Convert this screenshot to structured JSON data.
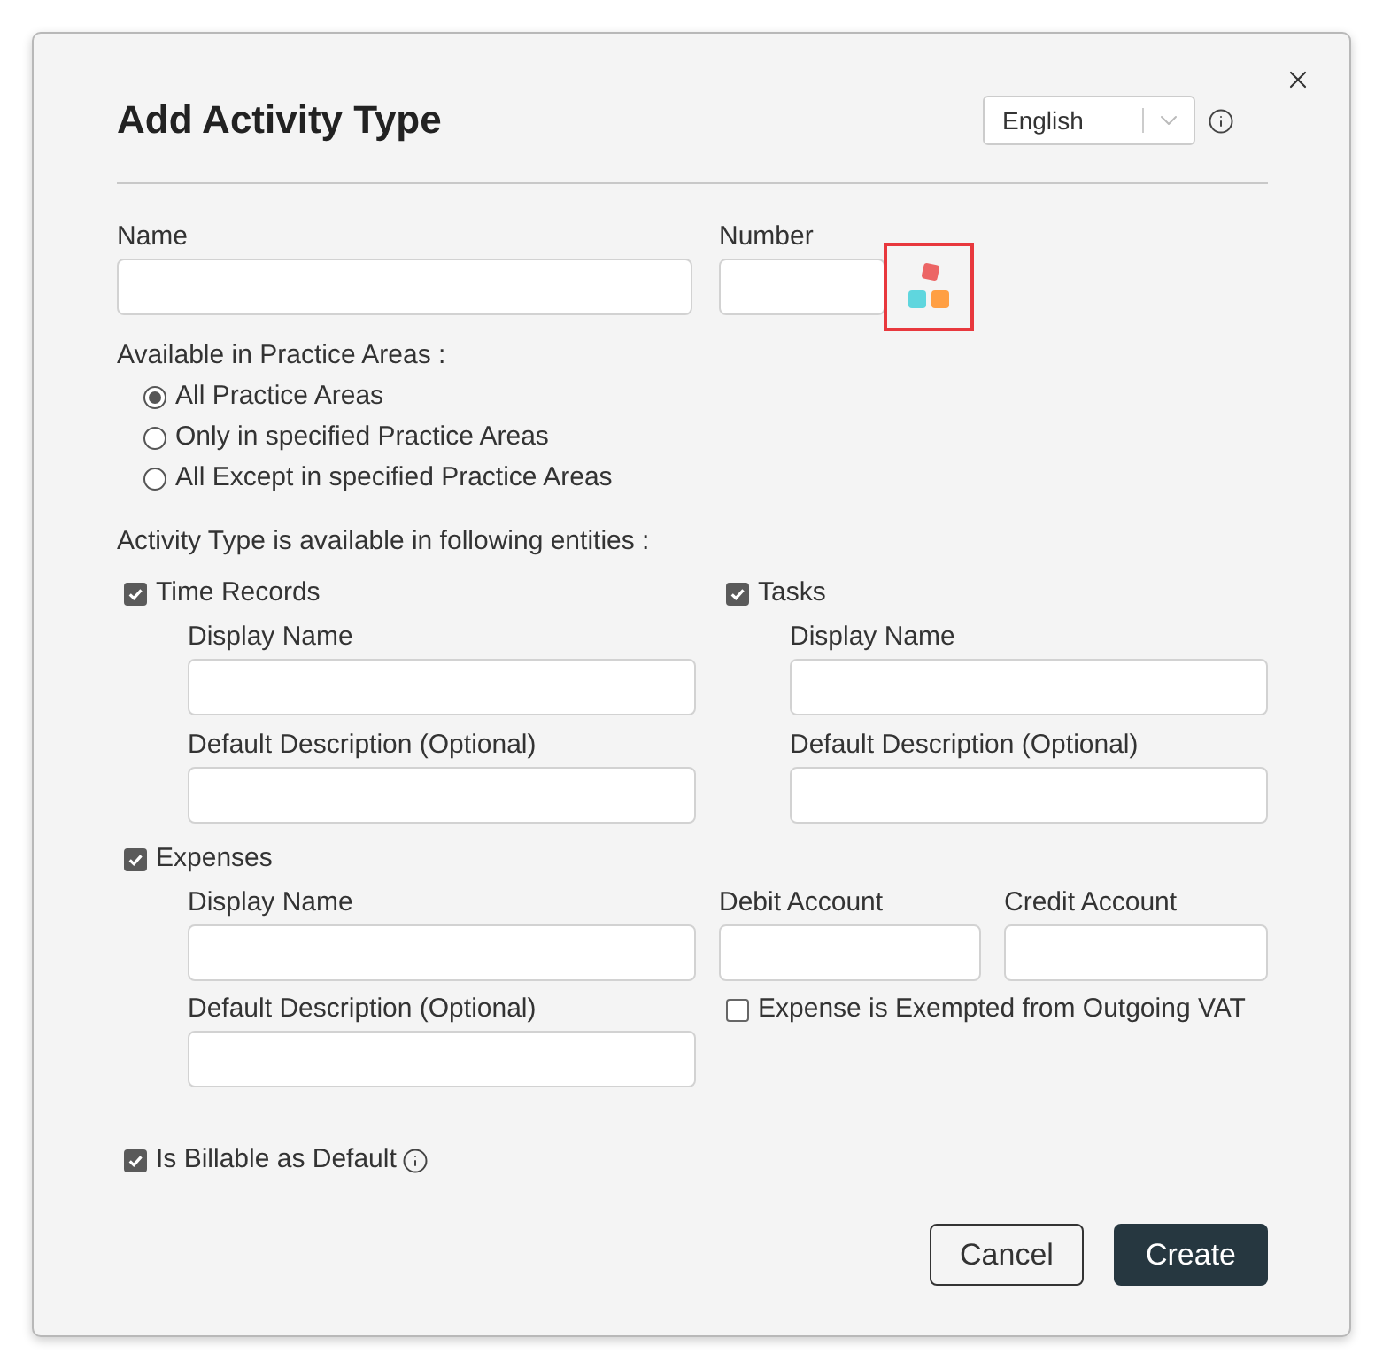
{
  "dialog": {
    "title": "Add Activity Type",
    "language_select": {
      "value": "English"
    }
  },
  "name_field": {
    "label": "Name"
  },
  "number_field": {
    "label": "Number",
    "generator_highlighted": true
  },
  "practice_areas": {
    "label": "Available in Practice Areas :",
    "options": [
      {
        "label": "All Practice Areas",
        "selected": true
      },
      {
        "label": "Only in specified Practice Areas",
        "selected": false
      },
      {
        "label": "All Except in specified Practice Areas",
        "selected": false
      }
    ]
  },
  "entities": {
    "label": "Activity Type is available in following entities :",
    "time_records": {
      "label": "Time Records",
      "checked": true,
      "display_name": {
        "label": "Display Name"
      },
      "default_description": {
        "label": "Default Description (Optional)"
      }
    },
    "tasks": {
      "label": "Tasks",
      "checked": true,
      "display_name": {
        "label": "Display Name"
      },
      "default_description": {
        "label": "Default Description (Optional)"
      }
    },
    "expenses": {
      "label": "Expenses",
      "checked": true,
      "display_name": {
        "label": "Display Name"
      },
      "default_description": {
        "label": "Default Description (Optional)"
      },
      "debit_account": {
        "label": "Debit Account"
      },
      "credit_account": {
        "label": "Credit Account"
      },
      "vat_exempt": {
        "label": "Expense is Exempted from Outgoing VAT",
        "checked": false
      }
    }
  },
  "billable": {
    "label": "Is Billable as Default",
    "checked": true
  },
  "buttons": [
    {
      "label": "Cancel",
      "kind": "secondary"
    },
    {
      "label": "Create",
      "kind": "primary"
    }
  ]
}
